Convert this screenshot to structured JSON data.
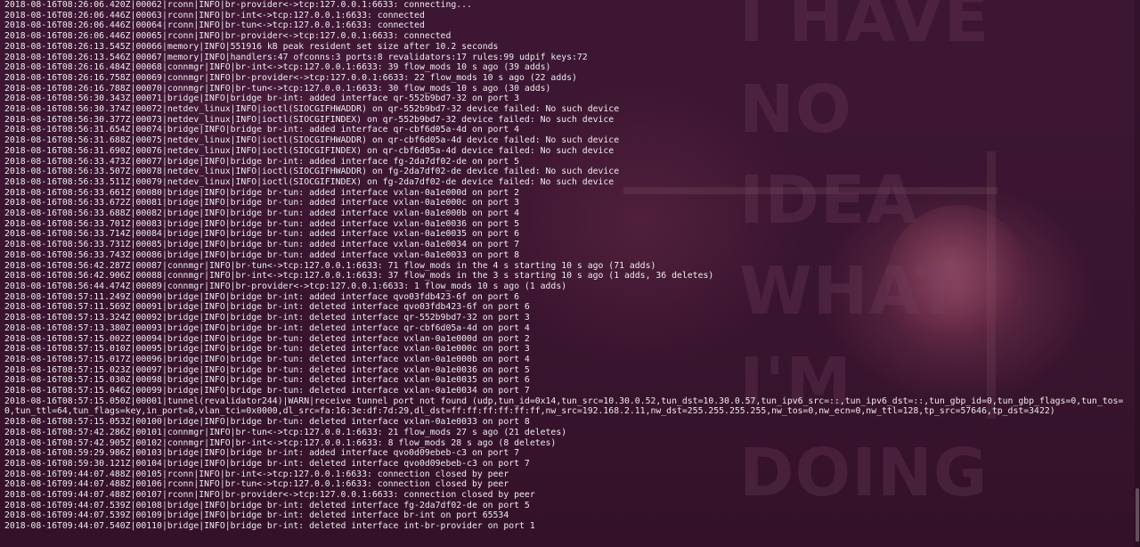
{
  "wallpaper": {
    "text": "I HAVE NO\nIDEA WHAT\nI'M DOING"
  },
  "terminal": {
    "lines": [
      "2018-08-16T08:26:06.420Z|00062|rconn|INFO|br-provider<->tcp:127.0.0.1:6633: connecting...",
      "2018-08-16T08:26:06.446Z|00063|rconn|INFO|br-int<->tcp:127.0.0.1:6633: connected",
      "2018-08-16T08:26:06.446Z|00064|rconn|INFO|br-tun<->tcp:127.0.0.1:6633: connected",
      "2018-08-16T08:26:06.446Z|00065|rconn|INFO|br-provider<->tcp:127.0.0.1:6633: connected",
      "2018-08-16T08:26:13.545Z|00066|memory|INFO|551916 kB peak resident set size after 10.2 seconds",
      "2018-08-16T08:26:13.546Z|00067|memory|INFO|handlers:47 ofconns:3 ports:8 revalidators:17 rules:99 udpif keys:72",
      "2018-08-16T08:26:16.484Z|00068|connmgr|INFO|br-int<->tcp:127.0.0.1:6633: 39 flow_mods 10 s ago (39 adds)",
      "2018-08-16T08:26:16.758Z|00069|connmgr|INFO|br-provider<->tcp:127.0.0.1:6633: 22 flow_mods 10 s ago (22 adds)",
      "2018-08-16T08:26:16.788Z|00070|connmgr|INFO|br-tun<->tcp:127.0.0.1:6633: 30 flow_mods 10 s ago (30 adds)",
      "2018-08-16T08:56:30.343Z|00071|bridge|INFO|bridge br-int: added interface qr-552b9bd7-32 on port 3",
      "2018-08-16T08:56:30.374Z|00072|netdev_linux|INFO|ioctl(SIOCGIFHWADDR) on qr-552b9bd7-32 device failed: No such device",
      "2018-08-16T08:56:30.377Z|00073|netdev_linux|INFO|ioctl(SIOCGIFINDEX) on qr-552b9bd7-32 device failed: No such device",
      "2018-08-16T08:56:31.654Z|00074|bridge|INFO|bridge br-int: added interface qr-cbf6d05a-4d on port 4",
      "2018-08-16T08:56:31.688Z|00075|netdev_linux|INFO|ioctl(SIOCGIFHWADDR) on qr-cbf6d05a-4d device failed: No such device",
      "2018-08-16T08:56:31.690Z|00076|netdev_linux|INFO|ioctl(SIOCGIFINDEX) on qr-cbf6d05a-4d device failed: No such device",
      "2018-08-16T08:56:33.473Z|00077|bridge|INFO|bridge br-int: added interface fg-2da7df02-de on port 5",
      "2018-08-16T08:56:33.507Z|00078|netdev_linux|INFO|ioctl(SIOCGIFHWADDR) on fg-2da7df02-de device failed: No such device",
      "2018-08-16T08:56:33.511Z|00079|netdev_linux|INFO|ioctl(SIOCGIFINDEX) on fg-2da7df02-de device failed: No such device",
      "2018-08-16T08:56:33.661Z|00080|bridge|INFO|bridge br-tun: added interface vxlan-0a1e000d on port 2",
      "2018-08-16T08:56:33.672Z|00081|bridge|INFO|bridge br-tun: added interface vxlan-0a1e000c on port 3",
      "2018-08-16T08:56:33.688Z|00082|bridge|INFO|bridge br-tun: added interface vxlan-0a1e000b on port 4",
      "2018-08-16T08:56:33.701Z|00083|bridge|INFO|bridge br-tun: added interface vxlan-0a1e0036 on port 5",
      "2018-08-16T08:56:33.714Z|00084|bridge|INFO|bridge br-tun: added interface vxlan-0a1e0035 on port 6",
      "2018-08-16T08:56:33.731Z|00085|bridge|INFO|bridge br-tun: added interface vxlan-0a1e0034 on port 7",
      "2018-08-16T08:56:33.743Z|00086|bridge|INFO|bridge br-tun: added interface vxlan-0a1e0033 on port 8",
      "2018-08-16T08:56:42.287Z|00087|connmgr|INFO|br-tun<->tcp:127.0.0.1:6633: 71 flow_mods in the 4 s starting 10 s ago (71 adds)",
      "2018-08-16T08:56:42.906Z|00088|connmgr|INFO|br-int<->tcp:127.0.0.1:6633: 37 flow_mods in the 3 s starting 10 s ago (1 adds, 36 deletes)",
      "2018-08-16T08:56:44.474Z|00089|connmgr|INFO|br-provider<->tcp:127.0.0.1:6633: 1 flow_mods 10 s ago (1 adds)",
      "2018-08-16T08:57:11.249Z|00090|bridge|INFO|bridge br-int: added interface qvo03fdb423-6f on port 6",
      "2018-08-16T08:57:11.569Z|00091|bridge|INFO|bridge br-int: deleted interface qvo03fdb423-6f on port 6",
      "2018-08-16T08:57:13.324Z|00092|bridge|INFO|bridge br-int: deleted interface qr-552b9bd7-32 on port 3",
      "2018-08-16T08:57:13.380Z|00093|bridge|INFO|bridge br-int: deleted interface qr-cbf6d05a-4d on port 4",
      "2018-08-16T08:57:15.002Z|00094|bridge|INFO|bridge br-tun: deleted interface vxlan-0a1e000d on port 2",
      "2018-08-16T08:57:15.010Z|00095|bridge|INFO|bridge br-tun: deleted interface vxlan-0a1e000c on port 3",
      "2018-08-16T08:57:15.017Z|00096|bridge|INFO|bridge br-tun: deleted interface vxlan-0a1e000b on port 4",
      "2018-08-16T08:57:15.023Z|00097|bridge|INFO|bridge br-tun: deleted interface vxlan-0a1e0036 on port 5",
      "2018-08-16T08:57:15.030Z|00098|bridge|INFO|bridge br-tun: deleted interface vxlan-0a1e0035 on port 6",
      "2018-08-16T08:57:15.046Z|00099|bridge|INFO|bridge br-tun: deleted interface vxlan-0a1e0034 on port 7",
      "2018-08-16T08:57:15.050Z|00001|tunnel(revalidator244)|WARN|receive tunnel port not found (udp,tun_id=0x14,tun_src=10.30.0.52,tun_dst=10.30.0.57,tun_ipv6_src=::,tun_ipv6_dst=::,tun_gbp_id=0,tun_gbp_flags=0,tun_tos=0,tun_ttl=64,tun_flags=key,in_port=8,vlan_tci=0x0000,dl_src=fa:16:3e:df:7d:29,dl_dst=ff:ff:ff:ff:ff:ff,nw_src=192.168.2.11,nw_dst=255.255.255.255,nw_tos=0,nw_ecn=0,nw_ttl=128,tp_src=57646,tp_dst=3422)",
      "2018-08-16T08:57:15.053Z|00100|bridge|INFO|bridge br-tun: deleted interface vxlan-0a1e0033 on port 8",
      "2018-08-16T08:57:42.286Z|00101|connmgr|INFO|br-tun<->tcp:127.0.0.1:6633: 21 flow_mods 27 s ago (21 deletes)",
      "2018-08-16T08:57:42.905Z|00102|connmgr|INFO|br-int<->tcp:127.0.0.1:6633: 8 flow_mods 28 s ago (8 deletes)",
      "2018-08-16T08:59:29.986Z|00103|bridge|INFO|bridge br-int: added interface qvo0d09ebeb-c3 on port 7",
      "2018-08-16T08:59:30.121Z|00104|bridge|INFO|bridge br-int: deleted interface qvo0d09ebeb-c3 on port 7",
      "2018-08-16T09:44:07.488Z|00105|rconn|INFO|br-int<->tcp:127.0.0.1:6633: connection closed by peer",
      "2018-08-16T09:44:07.488Z|00106|rconn|INFO|br-tun<->tcp:127.0.0.1:6633: connection closed by peer",
      "2018-08-16T09:44:07.488Z|00107|rconn|INFO|br-provider<->tcp:127.0.0.1:6633: connection closed by peer",
      "2018-08-16T09:44:07.539Z|00108|bridge|INFO|bridge br-int: deleted interface fg-2da7df02-de on port 5",
      "2018-08-16T09:44:07.539Z|00109|bridge|INFO|bridge br-int: deleted interface br-int on port 65534",
      "2018-08-16T09:44:07.540Z|00110|bridge|INFO|bridge br-int: deleted interface int-br-provider on port 1"
    ]
  }
}
